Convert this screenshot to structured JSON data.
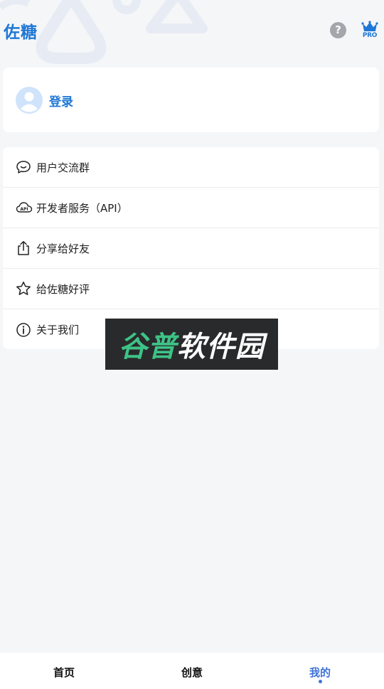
{
  "header": {
    "title": "佐糖",
    "help_icon": "help-icon",
    "help_glyph": "?",
    "pro_icon": "crown-icon",
    "pro_label": "PRO"
  },
  "login": {
    "avatar_icon": "avatar-icon",
    "label": "登录"
  },
  "menu": {
    "items": [
      {
        "icon": "chat-bubble-icon",
        "label": "用户交流群"
      },
      {
        "icon": "cloud-api-icon",
        "label": "开发者服务（API）"
      },
      {
        "icon": "share-icon",
        "label": "分享给好友"
      },
      {
        "icon": "star-icon",
        "label": "给佐糖好评"
      },
      {
        "icon": "info-icon",
        "label": "关于我们"
      }
    ]
  },
  "watermark": {
    "part1": "谷普",
    "part2": "软件园"
  },
  "tabbar": {
    "active": 2,
    "tabs": [
      {
        "label": "首页"
      },
      {
        "label": "创意"
      },
      {
        "label": "我的"
      }
    ]
  },
  "colors": {
    "brand": "#1f78d6",
    "tab_active": "#3f73d8",
    "background": "#f5f6f8",
    "watermark_green": "#3dc386"
  }
}
